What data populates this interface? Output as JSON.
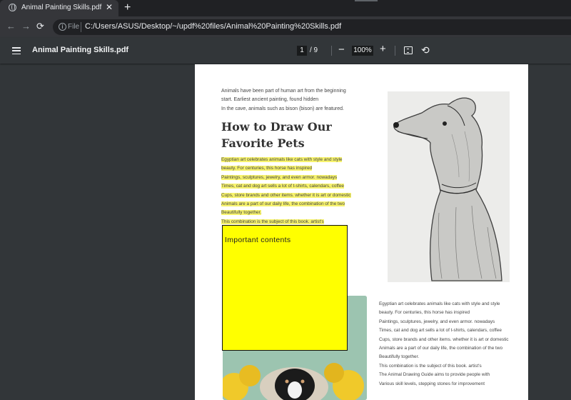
{
  "browser": {
    "tab_title": "Animal Painting Skills.pdf",
    "tab_close": "✕",
    "new_tab": "+",
    "scheme_label": "File",
    "url": "C:/Users/ASUS/Desktop/~/updf%20files/Animal%20Painting%20Skills.pdf"
  },
  "viewer": {
    "title": "Animal Painting Skills.pdf",
    "current_page": "1",
    "page_total": "/ 9",
    "zoom": "100%"
  },
  "document": {
    "intro_lines": [
      "Animals have been part of human art from the beginning",
      "start. Earliest ancient painting, found hidden",
      "In the cave, animals such as bison (bison) are featured."
    ],
    "heading_lines": [
      "How to Draw Our",
      "Favorite Pets"
    ],
    "highlighted_lines": [
      "Egyptian art celebrates animals like cats with style and style",
      "beauty. For centuries, this horse has inspired",
      "Paintings, sculptures, jewelry, and even armor. nowadays",
      "Times, cat and dog art sells a lot of t-shirts, calendars, coffee",
      "Cups, store brands and other items. whether it is art or domestic",
      "Animals are a part of our daily life, the combination of the two",
      "Beautifully together.",
      "This combination is the subject of this book. artist's"
    ],
    "right_column_lines": [
      "Egyptian art celebrates animals like cats with style and style",
      "beauty. For centuries, this horse has inspired",
      "Paintings, sculptures, jewelry, and even armor. nowadays",
      "Times, cat and dog art sells a lot of t-shirts, calendars, coffee",
      "Cups, store brands and other items. whether it is art or domestic",
      "Animals are a part of our daily life, the combination of the two",
      "Beautifully together.",
      "This combination is the subject of this book. artist's",
      "The Animal Drawing Guide aims to provide people with",
      "Various skill levels, stepping stones for improvement"
    ],
    "sticky_note": "Important contents"
  },
  "colors": {
    "highlight": "#f7f36d",
    "sticky_note": "#ffff00"
  }
}
